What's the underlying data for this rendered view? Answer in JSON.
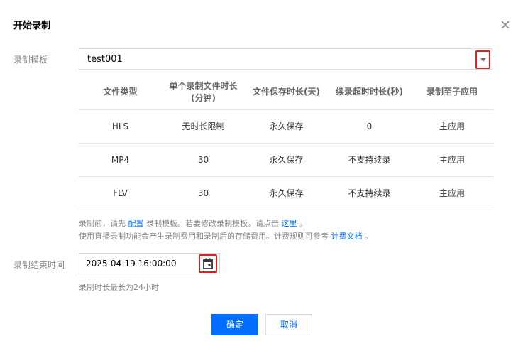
{
  "dialog": {
    "title": "开始录制",
    "close_icon": "close-icon"
  },
  "template_field": {
    "label": "录制模板",
    "value": "test001",
    "arrow_icon": "caret-down-icon"
  },
  "template_table": {
    "headers": [
      "文件类型",
      "单个录制文件时长\n(分钟)",
      "文件保存时长(天)",
      "续录超时时长(秒)",
      "录制至子应用"
    ],
    "rows": [
      [
        "HLS",
        "无时长限制",
        "永久保存",
        "0",
        "主应用"
      ],
      [
        "MP4",
        "30",
        "永久保存",
        "不支持续录",
        "主应用"
      ],
      [
        "FLV",
        "30",
        "永久保存",
        "不支持续录",
        "主应用"
      ]
    ]
  },
  "notes": {
    "line1_prefix": "录制前，请先",
    "line1_link1": "配置",
    "line1_mid": "录制模板。若要修改录制模板，请点击",
    "line1_link2": "这里",
    "line1_suffix": "。",
    "line2_prefix": "使用直播录制功能会产生录制费用和录制后的存储费用。计费规则可参考",
    "line2_link": "计费文档",
    "line2_suffix": "。"
  },
  "end_time_field": {
    "label": "录制结束时间",
    "value": "2025-04-19 16:00:00",
    "calendar_icon": "calendar-icon",
    "hint": "录制时长最长为24小时"
  },
  "footer": {
    "confirm_label": "确定",
    "cancel_label": "取消"
  },
  "colors": {
    "primary": "#006eff",
    "highlight_border": "#e02020"
  }
}
